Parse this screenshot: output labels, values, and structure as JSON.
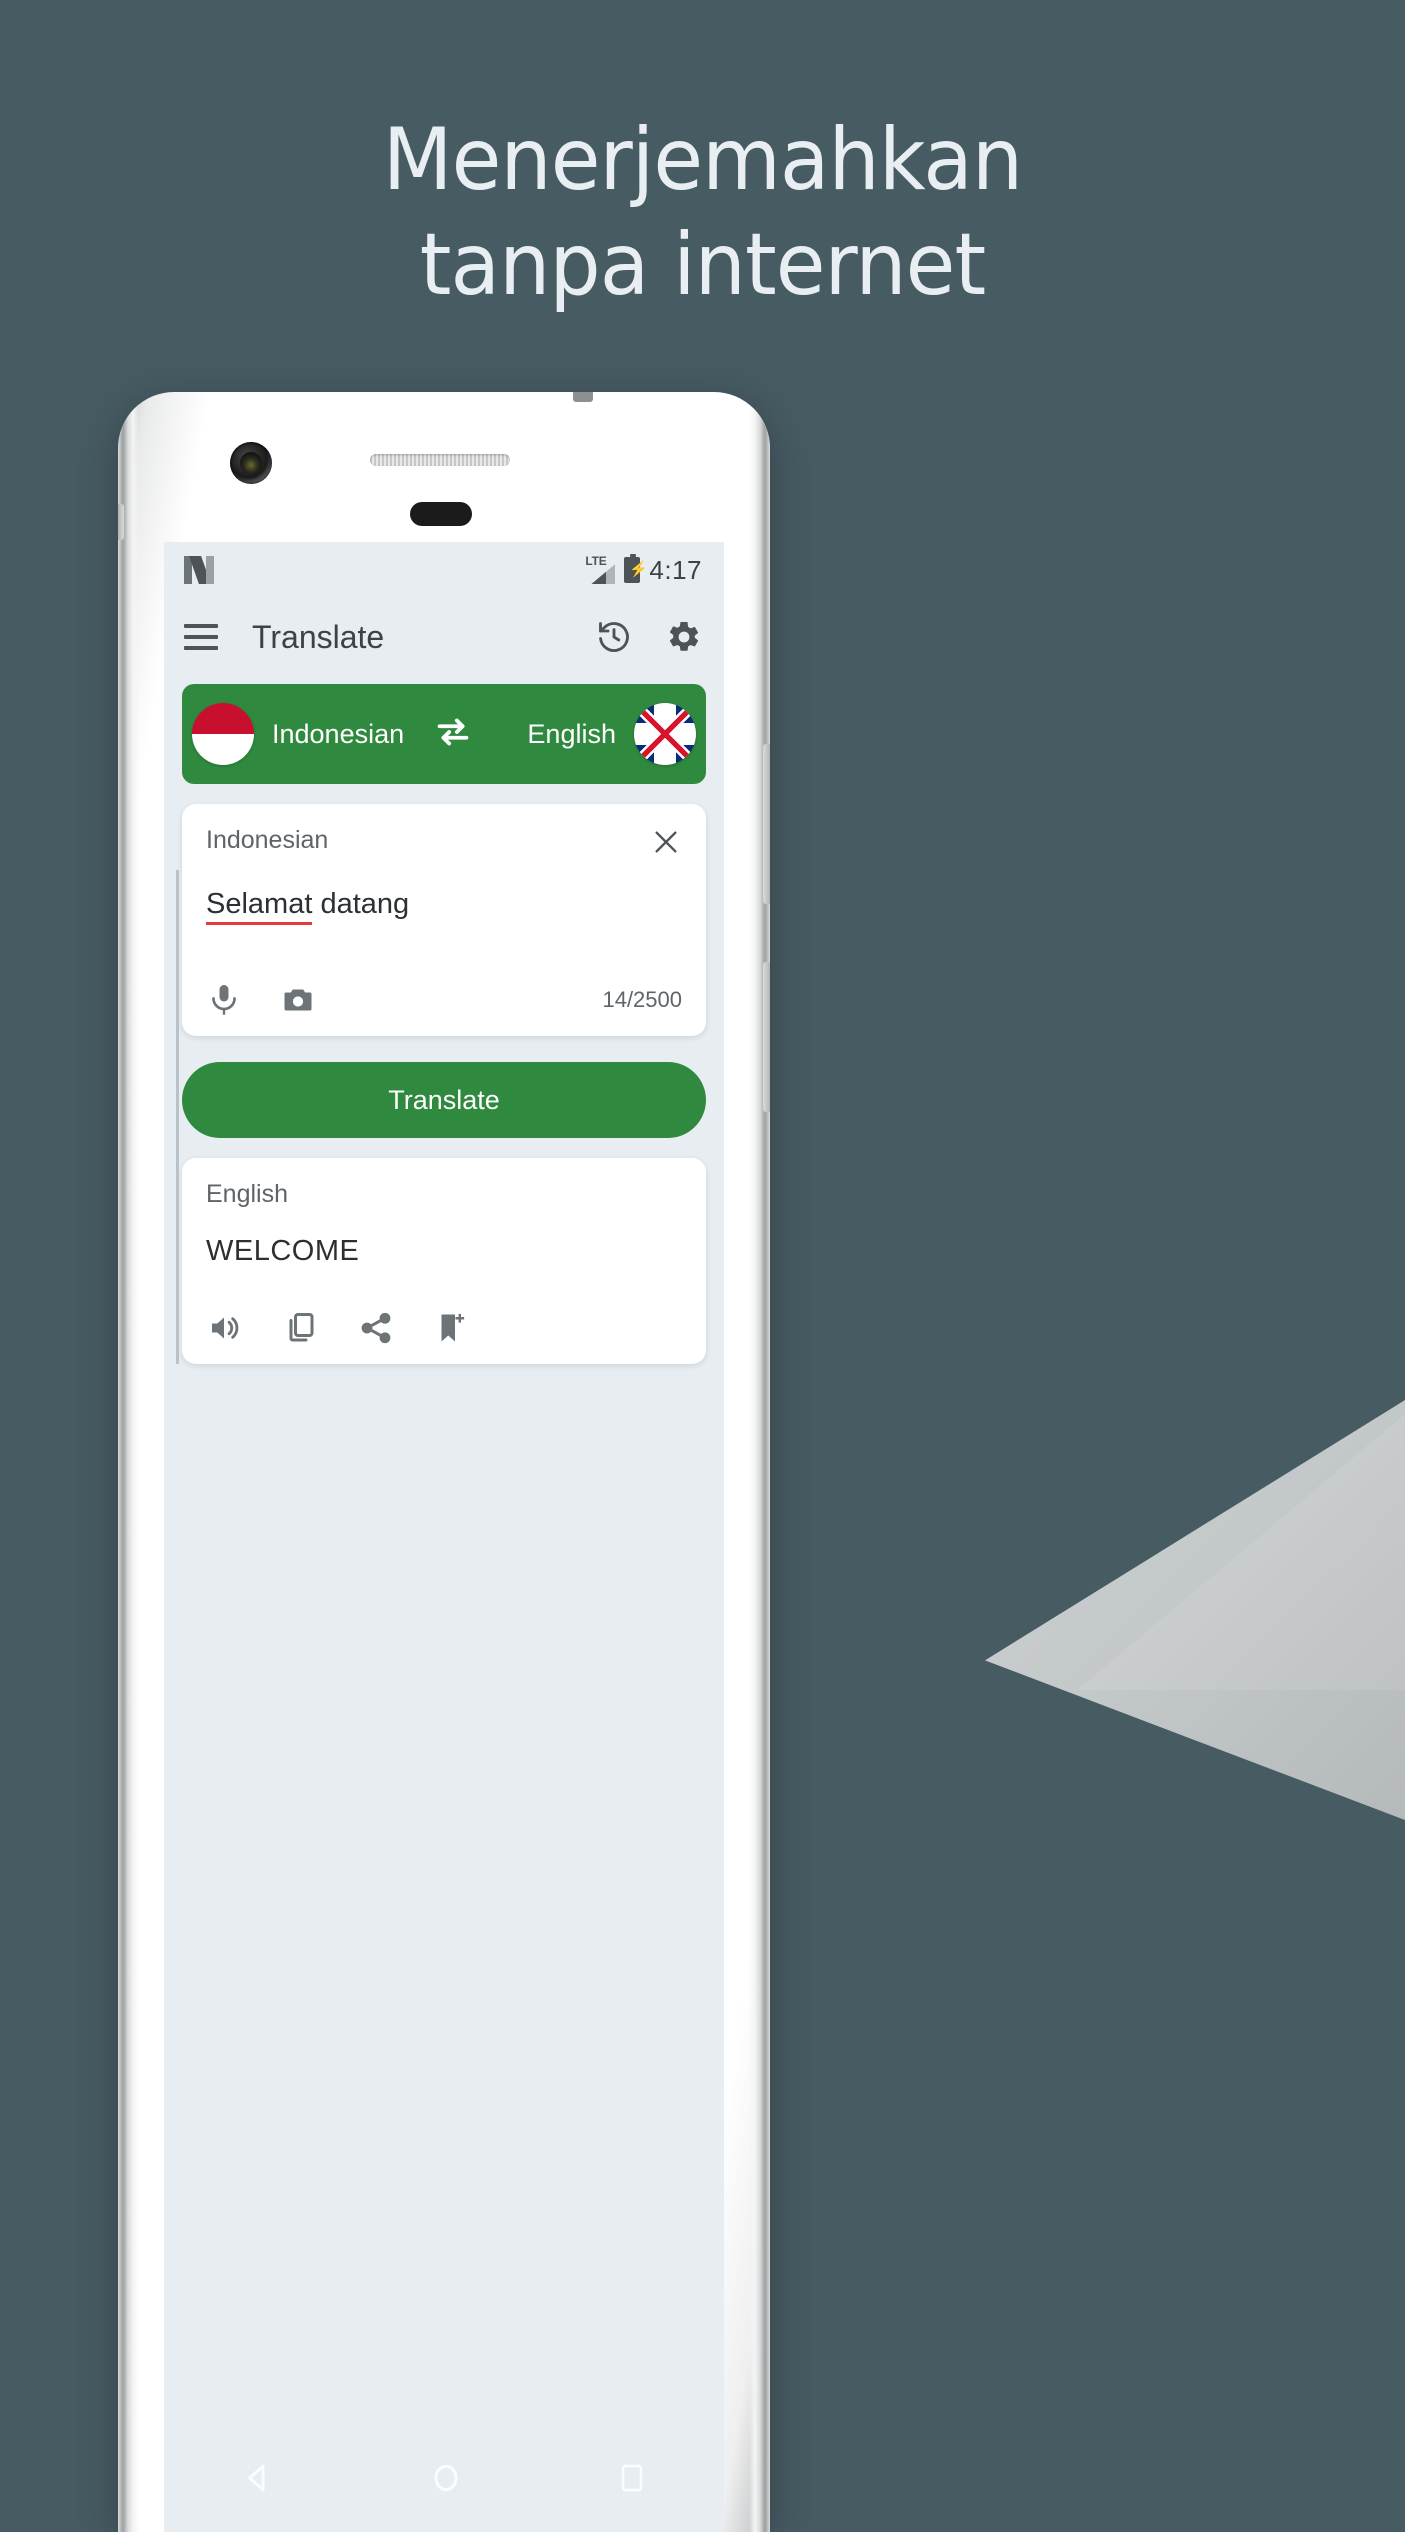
{
  "theme": {
    "background": "#475b63",
    "accent_green": "#2f8a3f",
    "screen_bg": "#e8edf1",
    "card_bg": "#ffffff",
    "text_dark": "#2c3033",
    "text_muted": "#5e6468",
    "error_red": "#e23b3b"
  },
  "promo": {
    "headline_line1": "Menerjemahkan",
    "headline_line2": "tanpa internet"
  },
  "status_bar": {
    "logo": "android-n-logo",
    "network": "LTE",
    "battery": "charging",
    "time": "4:17"
  },
  "app_bar": {
    "menu_icon": "hamburger-menu-icon",
    "title": "Translate",
    "history_icon": "history-icon",
    "settings_icon": "gear-icon"
  },
  "language_bar": {
    "source_flag": "indonesia-flag",
    "source_language": "Indonesian",
    "swap_icon": "swap-horizontal-icon",
    "target_language": "English",
    "target_flag": "united-kingdom-flag"
  },
  "input_card": {
    "language_label": "Indonesian",
    "clear_icon": "close-x-icon",
    "text_misspelled": "Selamat",
    "text_rest": " datang",
    "full_text": "Selamat datang",
    "mic_icon": "microphone-icon",
    "camera_icon": "camera-icon",
    "char_count": "14/2500",
    "char_used": 14,
    "char_limit": 2500
  },
  "translate_button": {
    "label": "Translate"
  },
  "output_card": {
    "language_label": "English",
    "translation": "WELCOME",
    "actions": [
      {
        "name": "speak-icon",
        "label": "Listen"
      },
      {
        "name": "copy-icon",
        "label": "Copy"
      },
      {
        "name": "share-icon",
        "label": "Share"
      },
      {
        "name": "bookmark-add-icon",
        "label": "Save"
      }
    ]
  },
  "nav_bar": {
    "back": "back-triangle-icon",
    "home": "home-circle-icon",
    "recents": "recents-square-icon"
  }
}
